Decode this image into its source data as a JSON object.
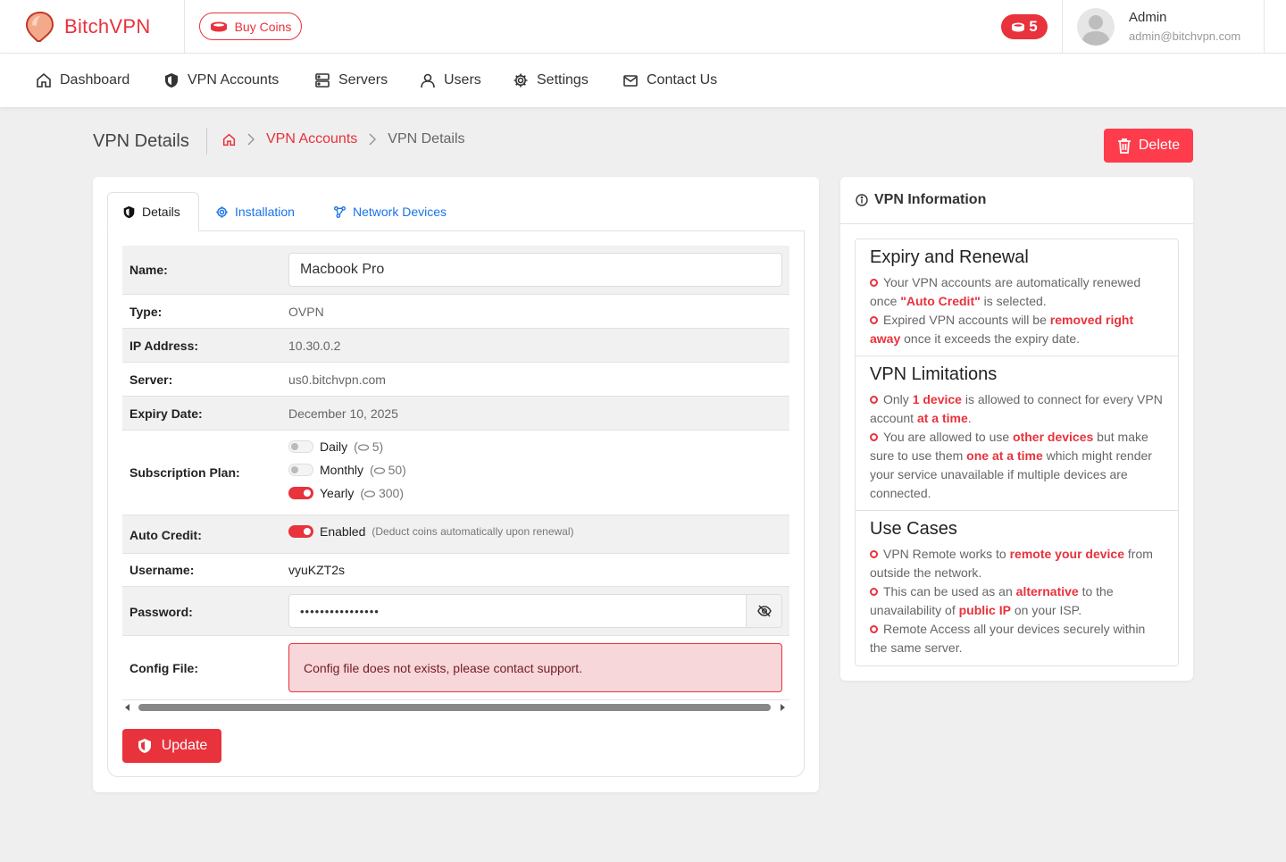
{
  "app": {
    "name": "BitchVPN"
  },
  "header": {
    "buy_coins_label": "Buy Coins",
    "coin_count": "5",
    "user_name": "Admin",
    "user_email": "admin@bitchvpn.com"
  },
  "nav": [
    {
      "label": "Dashboard",
      "icon": "home-icon"
    },
    {
      "label": "VPN Accounts",
      "icon": "shield-icon"
    },
    {
      "label": "Servers",
      "icon": "server-icon"
    },
    {
      "label": "Users",
      "icon": "user-icon"
    },
    {
      "label": "Settings",
      "icon": "gear-icon"
    },
    {
      "label": "Contact Us",
      "icon": "mail-icon"
    }
  ],
  "page": {
    "title": "VPN Details",
    "breadcrumb": [
      "VPN Accounts",
      "VPN Details"
    ],
    "delete_label": "Delete"
  },
  "tabs": [
    "Details",
    "Installation",
    "Network Devices"
  ],
  "details": {
    "name_label": "Name:",
    "name_value": "Macbook Pro",
    "type_label": "Type:",
    "type_value": "OVPN",
    "ip_label": "IP Address:",
    "ip_value": "10.30.0.2",
    "server_label": "Server:",
    "server_value": "us0.bitchvpn.com",
    "expiry_label": "Expiry Date:",
    "expiry_value": "December 10, 2025",
    "plan_label": "Subscription Plan:",
    "plans": [
      {
        "name": "Daily",
        "price": "5",
        "enabled": false
      },
      {
        "name": "Monthly",
        "price": "50",
        "enabled": false
      },
      {
        "name": "Yearly",
        "price": "300",
        "enabled": true
      }
    ],
    "auto_credit_label": "Auto Credit:",
    "auto_credit_value": "Enabled",
    "auto_credit_note": "(Deduct coins automatically upon renewal)",
    "username_label": "Username:",
    "username_value": "vyuKZT2s",
    "password_label": "Password:",
    "password_value": "••••••••••••••••",
    "config_label": "Config File:",
    "config_alert": "Config file does not exists, please contact support.",
    "update_label": "Update"
  },
  "info": {
    "title": "VPN Information",
    "sections": [
      {
        "heading": "Expiry and Renewal",
        "items": [
          [
            "Your VPN accounts are automatically renewed once ",
            "\"Auto Credit\"",
            " is selected."
          ],
          [
            "Expired VPN accounts will be ",
            "removed right away",
            " once it exceeds the expiry date."
          ]
        ]
      },
      {
        "heading": "VPN Limitations",
        "items": [
          [
            "Only ",
            "1 device",
            " is allowed to connect for every VPN account ",
            "at a time",
            "."
          ],
          [
            "You are allowed to use ",
            "other devices",
            " but make sure to use them ",
            "one at a time",
            " which might render your service unavailable if multiple devices are connected."
          ]
        ]
      },
      {
        "heading": "Use Cases",
        "items": [
          [
            "VPN Remote works to ",
            "remote your device",
            " from outside the network."
          ],
          [
            "This can be used as an ",
            "alternative",
            " to the unavailability of ",
            "public IP",
            " on your ISP."
          ],
          [
            "Remote Access all your devices securely within the same server."
          ]
        ]
      }
    ]
  },
  "colors": {
    "accent": "#e8323c",
    "link": "#1a73e8",
    "alert_bg": "#f8d7da"
  }
}
